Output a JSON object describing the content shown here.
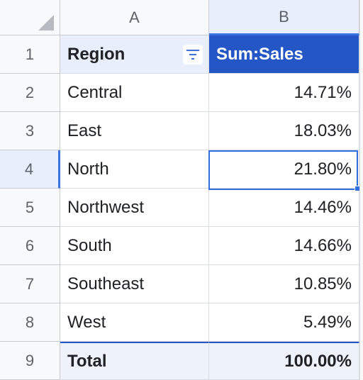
{
  "columns": [
    "A",
    "B"
  ],
  "rows": [
    "1",
    "2",
    "3",
    "4",
    "5",
    "6",
    "7",
    "8",
    "9"
  ],
  "header": {
    "region": "Region",
    "sum_sales": "Sum:Sales"
  },
  "data": [
    {
      "region": "Central",
      "value": "14.71%"
    },
    {
      "region": "East",
      "value": "18.03%"
    },
    {
      "region": "North",
      "value": "21.80%"
    },
    {
      "region": "Northwest",
      "value": "14.46%"
    },
    {
      "region": "South",
      "value": "14.66%"
    },
    {
      "region": "Southeast",
      "value": "10.85%"
    },
    {
      "region": "West",
      "value": "5.49%"
    }
  ],
  "total": {
    "label": "Total",
    "value": "100.00%"
  },
  "colors": {
    "accent": "#2457c5",
    "selection": "#2f6fde",
    "header_fill": "#e8eefb"
  },
  "selected_cell": "B4"
}
